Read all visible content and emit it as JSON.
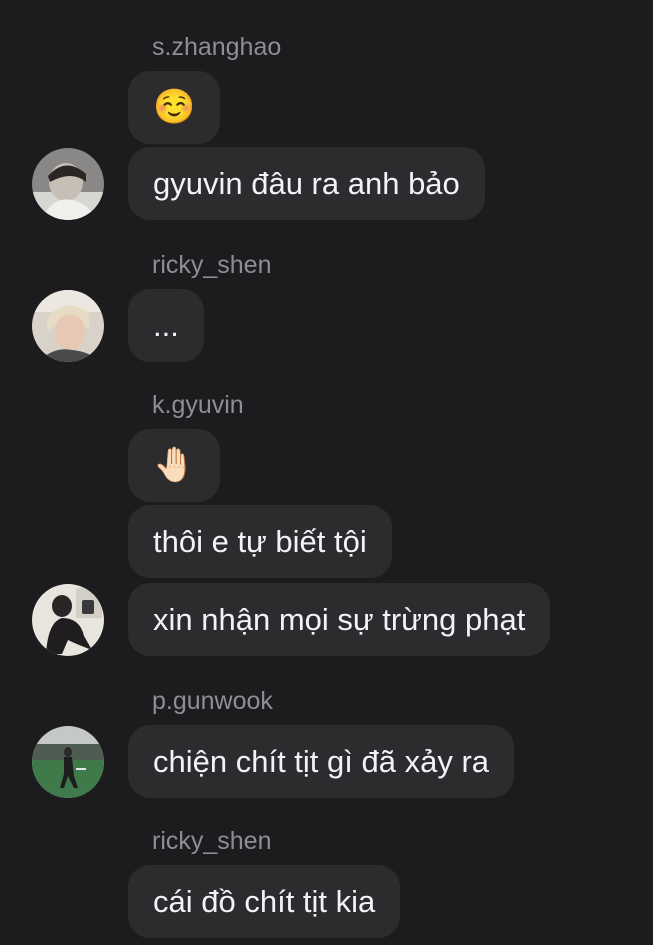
{
  "messages": [
    {
      "sender": "s.zhanghao"
    },
    {
      "text": "☺️"
    },
    {
      "text": "gyuvin đâu ra anh bảo"
    },
    {
      "sender": "ricky_shen"
    },
    {
      "text": "..."
    },
    {
      "sender": "k.gyuvin"
    },
    {
      "text": "🤚🏻"
    },
    {
      "text": "thôi e tự biết tội"
    },
    {
      "text": "xin nhận mọi sự trừng phạt"
    },
    {
      "sender": "p.gunwook"
    },
    {
      "text": "chiện chít tịt gì đã xảy ra"
    },
    {
      "sender": "ricky_shen"
    },
    {
      "text": "cái đồ chít tịt kia"
    }
  ],
  "colors": {
    "background": "#1c1c1e",
    "bubble": "#2c2c2e",
    "text": "#f2f2f7",
    "sender": "#8e8e93"
  }
}
